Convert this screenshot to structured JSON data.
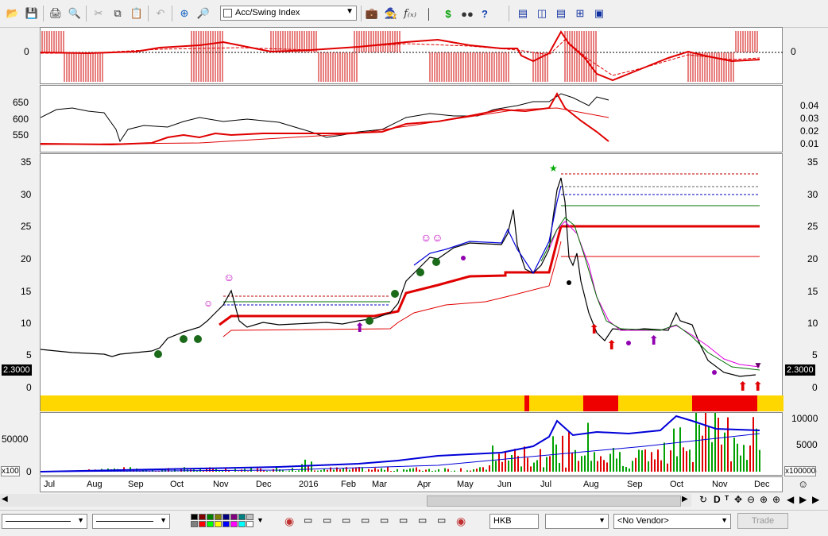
{
  "toolbar": {
    "indicator_selected": "Acc/Swing Index",
    "icons": [
      "open-icon",
      "save-icon",
      "print-icon",
      "print-preview-icon",
      "cut-icon",
      "copy-icon",
      "paste-icon",
      "undo-icon",
      "crosshair-icon",
      "zoom-icon",
      "indicator-select",
      "portfolio-icon",
      "wizard-icon",
      "formula-icon",
      "chart-icon",
      "dollar-icon",
      "binoculars-icon",
      "help-icon",
      "layout-1-icon",
      "layout-2-icon",
      "layout-3-icon",
      "layout-4-icon",
      "layout-5-icon"
    ]
  },
  "panes": {
    "acc_swing": {
      "left_label": "0",
      "right_label": "0"
    },
    "compare": {
      "left_labels": [
        "650",
        "600",
        "550"
      ],
      "right_labels": [
        "0.04",
        "0.03",
        "0.02",
        "0.01"
      ]
    },
    "price": {
      "left_labels": [
        "35",
        "30",
        "25",
        "20",
        "15",
        "10",
        "5",
        "0"
      ],
      "right_labels": [
        "35",
        "30",
        "25",
        "20",
        "15",
        "10",
        "5",
        "0"
      ],
      "last_price_left": "2.3000",
      "last_price_right": "2.3000"
    },
    "volume": {
      "left_labels": [
        "50000",
        "0"
      ],
      "left_unit": "x100",
      "right_labels": [
        "10000",
        "5000",
        "0"
      ],
      "right_unit": "x100000"
    }
  },
  "time_axis": [
    "Jul",
    "Aug",
    "Sep",
    "Oct",
    "Nov",
    "Dec",
    "2016",
    "Feb",
    "Mar",
    "Apr",
    "May",
    "Jun",
    "Jul",
    "Aug",
    "Sep",
    "Oct",
    "Nov",
    "Dec"
  ],
  "scroll_controls": [
    "refresh-icon",
    "d-icon",
    "t-icon",
    "move-icon",
    "zoom-out-icon",
    "zoom-in-icon",
    "prev-icon",
    "next-icon"
  ],
  "bottom": {
    "exchange": "HKB",
    "vendor": "<No Vendor>",
    "trade_label": "Trade",
    "palette": [
      "#000000",
      "#800000",
      "#008000",
      "#808000",
      "#000080",
      "#800080",
      "#008080",
      "#c0c0c0",
      "#808080",
      "#ff0000",
      "#00ff00",
      "#ffff00",
      "#0000ff",
      "#ff00ff",
      "#00ffff",
      "#ffffff"
    ]
  },
  "colors": {
    "red": "#e00000",
    "blue": "#0000d8",
    "band_yellow": "#ffd700",
    "band_red": "#ee0000"
  }
}
